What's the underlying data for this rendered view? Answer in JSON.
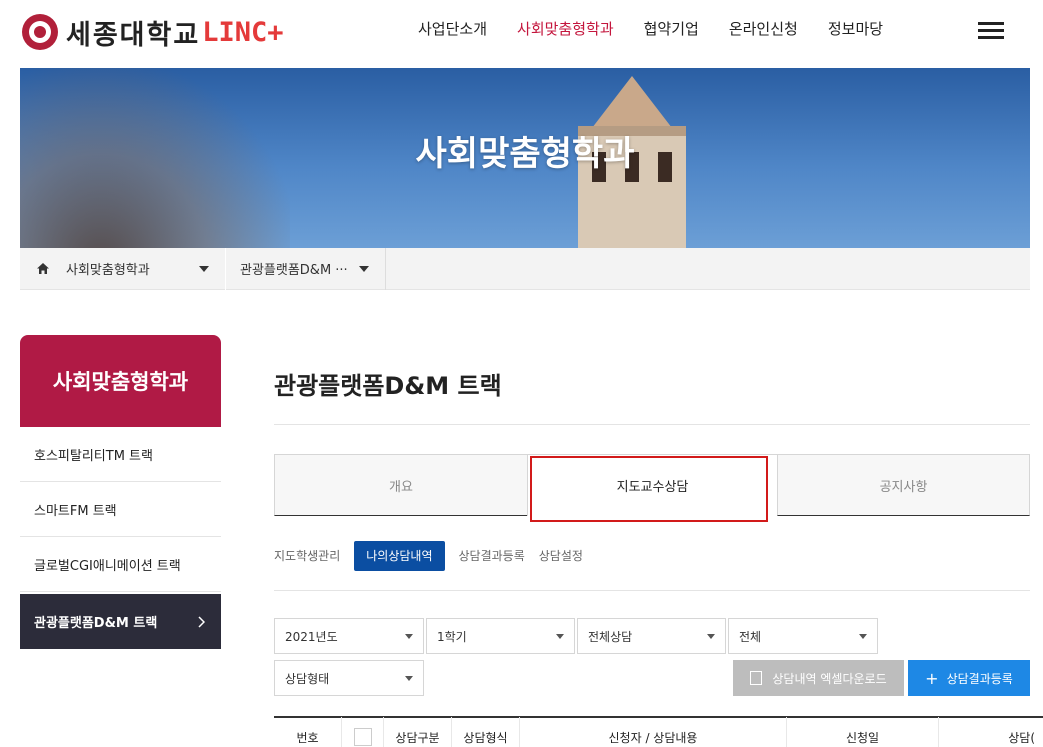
{
  "header": {
    "logo_text": "세종대학교",
    "logo_brand": "LINC+",
    "nav": [
      "사업단소개",
      "사회맞춤형학과",
      "협약기업",
      "온라인신청",
      "정보마당"
    ],
    "active_nav_index": 1
  },
  "hero": {
    "title": "사회맞춤형학과"
  },
  "breadcrumb": {
    "level1": "사회맞춤형학과",
    "level2": "관광플랫폼D&M ···"
  },
  "sidebar": {
    "title": "사회맞춤형학과",
    "items": [
      "호스피탈리티TM 트랙",
      "스마트FM 트랙",
      "글로벌CGI애니메이션 트랙",
      "관광플랫폼D&M 트랙"
    ],
    "active_index": 3
  },
  "main": {
    "title": "관광플랫폼D&M 트랙",
    "tabs": [
      "개요",
      "지도교수상담",
      "공지사항"
    ],
    "active_tab_index": 1,
    "subtabs": [
      "지도학생관리",
      "나의상담내역",
      "상담결과등록",
      "상담설정"
    ],
    "active_subtab_index": 1,
    "filters": {
      "year": "2021년도",
      "semester": "1학기",
      "consult_scope": "전체상담",
      "status": "전체",
      "consult_type": "상담형태"
    },
    "buttons": {
      "excel": "상담내역 엑셀다운로드",
      "register": "상담결과등록"
    },
    "table_headers": [
      "번호",
      "",
      "상담구분",
      "상담형식",
      "신청자 / 상담내용",
      "신청일",
      "상담("
    ]
  },
  "colors": {
    "accent": "#c4163d",
    "sidebar_head": "#b01a45",
    "primary_blue": "#0b4ea2",
    "register_blue": "#1e88e5",
    "highlight_red": "#d21a1a"
  }
}
